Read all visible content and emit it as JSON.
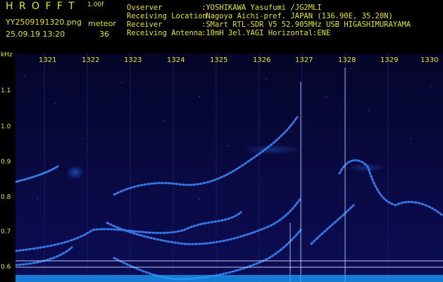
{
  "app": {
    "title": "HROFFT",
    "version": "1.00f"
  },
  "file": {
    "name": "YY2509191320.png",
    "datetime": "25.09.19 13:20"
  },
  "meteor": {
    "label": "meteor",
    "count": "36"
  },
  "info": [
    {
      "key": "Ovserver",
      "value": ":YOSHIKAWA Yasufumi /JG2MLI"
    },
    {
      "key": "Receiving Location",
      "value": ":Nagoya Aichi-pref. JAPAN (136.90E, 35.20N)"
    },
    {
      "key": "Receiver",
      "value": ":SMart RTL-SDR V5 52.905MHz USB HIGASHIMURAYAMA"
    },
    {
      "key": "Receiving Antenna",
      "value": ":10mH 3el.YAGI Horizontal:ENE"
    }
  ],
  "axis": {
    "y_unit": "kHz",
    "y_ticks": [
      "1.1",
      "1.0",
      "0.9",
      "0.8",
      "0.7",
      "0.6"
    ],
    "x_ticks": [
      "1321",
      "1322",
      "1323",
      "1324",
      "1325",
      "1326",
      "1327",
      "1328",
      "1329",
      "1330"
    ]
  },
  "colors": {
    "label": "#e6e600",
    "signal": "#3c8cff",
    "background": "#08083a"
  }
}
